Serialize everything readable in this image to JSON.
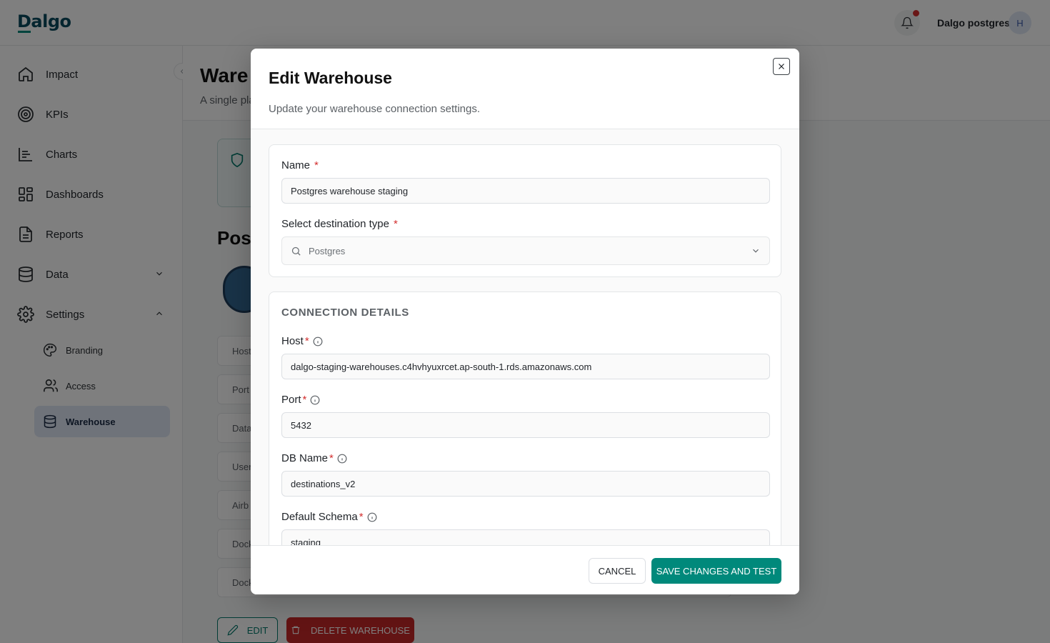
{
  "app": {
    "logo": "Dalgo",
    "user_name": "Dalgo postgres",
    "avatar_initial": "H"
  },
  "sidebar": {
    "items": [
      {
        "label": "Impact",
        "icon": "home-icon"
      },
      {
        "label": "KPIs",
        "icon": "target-icon"
      },
      {
        "label": "Charts",
        "icon": "bar-chart-icon"
      },
      {
        "label": "Dashboards",
        "icon": "dashboard-grid-icon"
      },
      {
        "label": "Reports",
        "icon": "document-icon"
      },
      {
        "label": "Data",
        "icon": "database-icon",
        "expanded": false
      },
      {
        "label": "Settings",
        "icon": "gear-icon",
        "expanded": true
      }
    ],
    "sub_items": [
      {
        "label": "Branding",
        "icon": "palette-icon"
      },
      {
        "label": "Access",
        "icon": "users-icon"
      },
      {
        "label": "Warehouse",
        "icon": "database-icon",
        "active": true
      }
    ]
  },
  "page": {
    "title": "Ware",
    "subtitle": "A single pla",
    "section_title": "Pos",
    "field_rows": [
      "Host",
      "Port",
      "Data",
      "User",
      "Airb",
      "Dock",
      "Dock"
    ],
    "edit_label": "EDIT",
    "delete_label": "DELETE WAREHOUSE"
  },
  "modal": {
    "title": "Edit Warehouse",
    "subtitle": "Update your warehouse connection settings.",
    "name_label": "Name",
    "name_value": "Postgres warehouse staging",
    "dest_label": "Select destination type",
    "dest_value": "Postgres",
    "connection_title": "CONNECTION DETAILS",
    "fields": [
      {
        "label": "Host",
        "value": "dalgo-staging-warehouses.c4hvhyuxrcet.ap-south-1.rds.amazonaws.com"
      },
      {
        "label": "Port",
        "value": "5432"
      },
      {
        "label": "DB Name",
        "value": "destinations_v2"
      },
      {
        "label": "Default Schema",
        "value": "staging"
      }
    ],
    "required_mark": "*",
    "cancel_label": "CANCEL",
    "save_label": "SAVE CHANGES AND TEST"
  },
  "colors": {
    "accent": "#00897b",
    "danger": "#c62828",
    "active_nav": "#dfe7f5"
  }
}
